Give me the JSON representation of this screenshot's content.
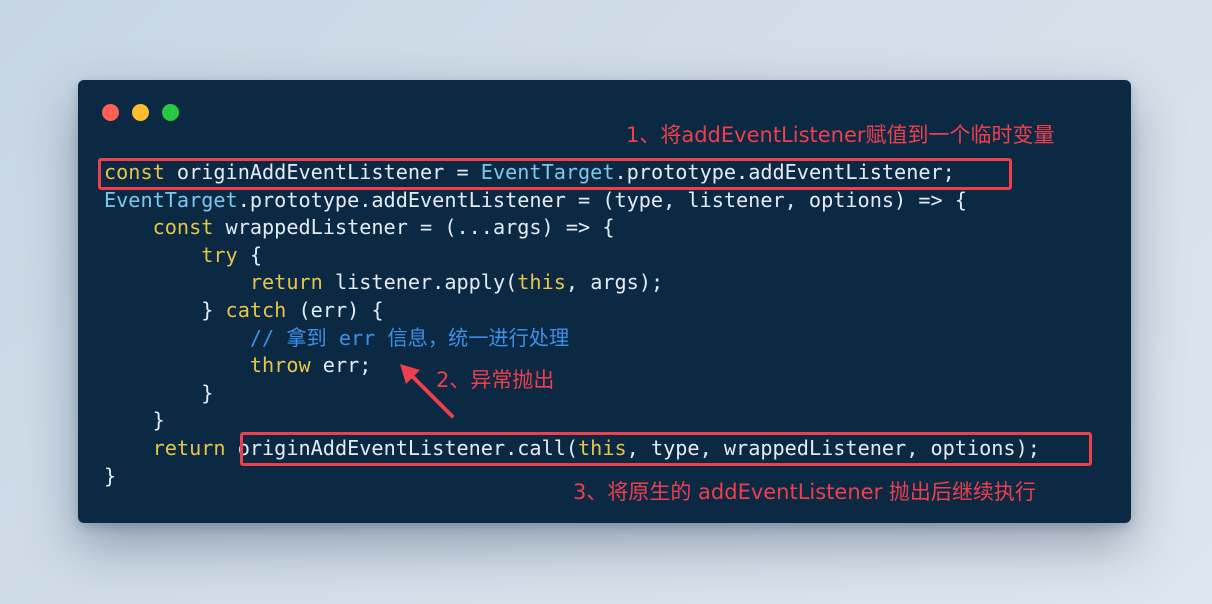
{
  "colors": {
    "background": "#d3dfea",
    "window": "#0c2944",
    "annotation": "#ee3f4c",
    "keyword": "#e7c547",
    "class": "#7cc8ec",
    "comment": "#3d8fe8",
    "text": "#e3ecf4"
  },
  "window_controls": [
    "close",
    "minimize",
    "maximize"
  ],
  "code": {
    "l1": {
      "kw": "const",
      "rest1": " originAddEventListener = ",
      "cls": "EventTarget",
      "rest2": ".prototype.addEventListener;"
    },
    "l2": {
      "cls": "EventTarget",
      "rest": ".prototype.addEventListener = (type, listener, options) => {"
    },
    "l3": {
      "indent": "    ",
      "kw": "const",
      "rest": " wrappedListener = (...args) => {"
    },
    "l4": {
      "indent": "        ",
      "kw": "try",
      "rest": " {"
    },
    "l5": {
      "indent": "            ",
      "kw": "return",
      "rest1": " listener.apply(",
      "kw2": "this",
      "rest2": ", args);"
    },
    "l6": {
      "indent": "        ",
      "rest1": "} ",
      "kw": "catch",
      "rest2": " (err) {"
    },
    "l7": {
      "indent": "            ",
      "comment": "// 拿到 err 信息，统一进行处理"
    },
    "l8": {
      "indent": "            ",
      "kw": "throw",
      "rest": " err;"
    },
    "l9": {
      "indent": "        ",
      "rest": "}"
    },
    "l10": {
      "indent": "    ",
      "rest": "}"
    },
    "l11": {
      "indent": "    ",
      "kw": "return",
      "rest1": " originAddEventListener.call(",
      "kw2": "this",
      "rest2": ", type, wrappedListener, options);"
    },
    "l12": {
      "rest": "}"
    }
  },
  "annotations": {
    "note1": "1、将addEventListener赋值到一个临时变量",
    "note2": "2、异常抛出",
    "note3": "3、将原生的 addEventListener 抛出后继续执行"
  }
}
